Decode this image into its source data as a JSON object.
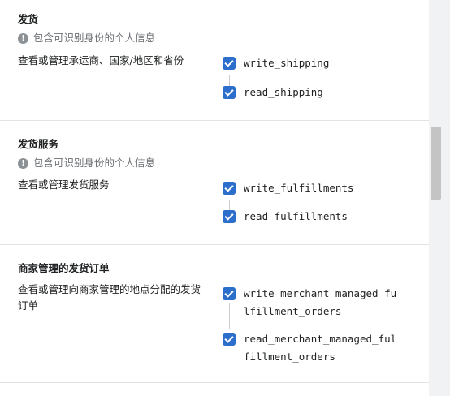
{
  "sections": [
    {
      "title": "发货",
      "pii_note": "包含可识别身份的个人信息",
      "description": "查看或管理承运商、国家/地区和省份",
      "scopes": [
        "write_shipping",
        "read_shipping"
      ]
    },
    {
      "title": "发货服务",
      "pii_note": "包含可识别身份的个人信息",
      "description": "查看或管理发货服务",
      "scopes": [
        "write_fulfillments",
        "read_fulfillments"
      ]
    },
    {
      "title": "商家管理的发货订单",
      "description": "查看或管理向商家管理的地点分配的发货订单",
      "scopes": [
        "write_merchant_managed_fulfillment_orders",
        "read_merchant_managed_fulfillment_orders"
      ]
    }
  ],
  "icons": {
    "pii": "alert-circle-icon",
    "check": "checkmark-icon"
  },
  "colors": {
    "checkbox": "#2c6ecb",
    "muted_text": "#6d7175",
    "divider": "#e1e3e5"
  }
}
